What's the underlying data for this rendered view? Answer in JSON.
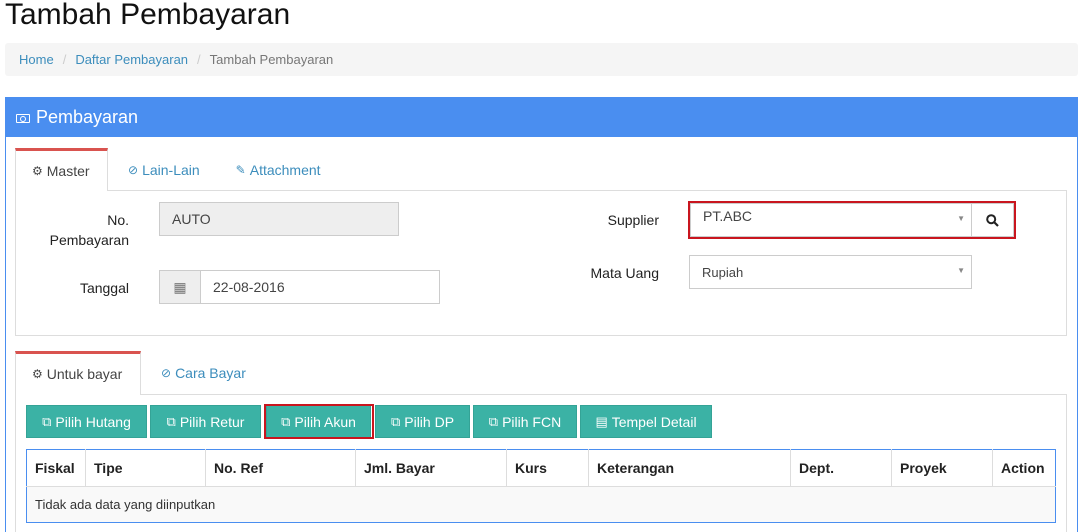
{
  "page": {
    "title": "Tambah Pembayaran"
  },
  "breadcrumb": [
    {
      "label": "Home"
    },
    {
      "label": "Daftar Pembayaran"
    },
    {
      "label": "Tambah Pembayaran"
    }
  ],
  "panel": {
    "title": "Pembayaran",
    "icon": "money-icon"
  },
  "top_tabs": [
    {
      "label": "Master",
      "icon": "cogs-icon",
      "active": true
    },
    {
      "label": "Lain-Lain",
      "icon": "check-circle-icon",
      "active": false
    },
    {
      "label": "Attachment",
      "icon": "paperclip-icon",
      "active": false
    }
  ],
  "form": {
    "no_pembayaran": {
      "label": "No. Pembayaran",
      "value": "AUTO"
    },
    "tanggal": {
      "label": "Tanggal",
      "value": "22-08-2016",
      "icon": "calendar-icon"
    },
    "supplier": {
      "label": "Supplier",
      "value": "PT.ABC",
      "search_icon": "search-icon"
    },
    "mata_uang": {
      "label": "Mata Uang",
      "value": "Rupiah"
    }
  },
  "bottom_tabs": [
    {
      "label": "Untuk bayar",
      "icon": "cogs-icon",
      "active": true
    },
    {
      "label": "Cara Bayar",
      "icon": "check-circle-icon",
      "active": false
    }
  ],
  "buttons": [
    {
      "label": "Pilih Hutang",
      "icon": "copy-icon"
    },
    {
      "label": "Pilih Retur",
      "icon": "copy-icon"
    },
    {
      "label": "Pilih Akun",
      "icon": "copy-icon"
    },
    {
      "label": "Pilih DP",
      "icon": "copy-icon"
    },
    {
      "label": "Pilih FCN",
      "icon": "copy-icon"
    },
    {
      "label": "Tempel Detail",
      "icon": "paste-icon"
    }
  ],
  "table": {
    "columns": [
      "Fiskal",
      "Tipe",
      "No. Ref",
      "Jml. Bayar",
      "Kurs",
      "Keterangan",
      "Dept.",
      "Proyek",
      "Action"
    ],
    "empty_message": "Tidak ada data yang diinputkan"
  },
  "colors": {
    "primary": "#4a8ef0",
    "teal": "#3bb2a5",
    "highlight": "#c9151e",
    "tab_accent": "#d9534f",
    "link": "#3c8dbc"
  }
}
